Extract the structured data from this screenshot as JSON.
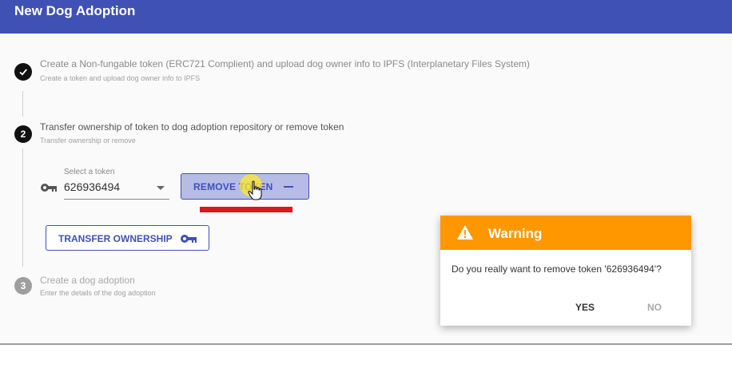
{
  "app": {
    "title": "New Dog Adoption"
  },
  "steps": [
    {
      "marker": "✓",
      "title": "Create a Non-fungable token (ERC721 Complient) and upload dog owner info to IPFS (Interplanetary Files System)",
      "subtitle": "Create a token and upload dog owner info to IPFS",
      "state": "completed"
    },
    {
      "marker": "2",
      "title": "Transfer ownership of token to dog adoption repository or remove token",
      "subtitle": "Transfer ownership or remove",
      "state": "active"
    },
    {
      "marker": "3",
      "title": "Create a dog adoption",
      "subtitle": "Enter the details of the dog adoption",
      "state": "pending"
    }
  ],
  "token_select": {
    "label": "Select a token",
    "value": "626936494"
  },
  "buttons": {
    "remove_token": "REMOVE TOKEN",
    "transfer_ownership": "TRANSFER OWNERSHIP"
  },
  "dialog": {
    "title": "Warning",
    "message": "Do you really want to remove token '626936494'?",
    "yes": "YES",
    "no": "NO"
  },
  "colors": {
    "primary": "#3f51b5",
    "warning": "#ff9800",
    "highlight": "#e0161a"
  },
  "icons": [
    "check-icon",
    "key-icon",
    "minus-icon",
    "warning-icon",
    "hand-cursor-icon"
  ]
}
